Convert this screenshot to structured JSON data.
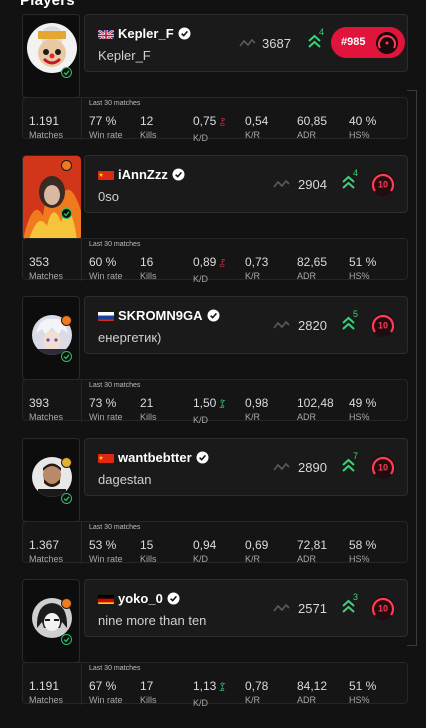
{
  "section": {
    "title": "Players"
  },
  "stat_labels": {
    "matches": "Matches",
    "winrate": "Win rate",
    "kills": "Kills",
    "kd": "K/D",
    "kr": "K/R",
    "adr": "ADR",
    "hs": "HS%",
    "last30": "Last 30 matches"
  },
  "players": [
    {
      "nick": "Kepler_F",
      "subtitle": "Kepler_F",
      "flag": "gb",
      "elo": "3687",
      "delta": "4",
      "rank": "#985",
      "level": "10",
      "matches": "1.191",
      "winrate": "77 %",
      "kills": "12",
      "kd": "0,75",
      "kd_trend": "down",
      "kr": "0,54",
      "adr": "60,85",
      "hs": "40 %",
      "avatar": "clown-avatar"
    },
    {
      "nick": "iAnnZzz",
      "subtitle": "0so",
      "flag": "cn",
      "elo": "2904",
      "delta": "4",
      "level": "10",
      "matches": "353",
      "winrate": "60 %",
      "kills": "16",
      "kd": "0,89",
      "kd_trend": "down",
      "kr": "0,73",
      "adr": "82,65",
      "hs": "51 %",
      "avatar": "fire-avatar"
    },
    {
      "nick": "SKROMN9GA",
      "subtitle": "енергетик)",
      "flag": "ru",
      "elo": "2820",
      "delta": "5",
      "level": "10",
      "matches": "393",
      "winrate": "73 %",
      "kills": "21",
      "kd": "1,50",
      "kd_trend": "up",
      "kr": "0,98",
      "adr": "102,48",
      "hs": "49 %",
      "avatar": "anime-avatar"
    },
    {
      "nick": "wantbebtter",
      "subtitle": "dagestan",
      "flag": "cn",
      "elo": "2890",
      "delta": "7",
      "level": "10",
      "matches": "1.367",
      "winrate": "53 %",
      "kills": "15",
      "kd": "0,94",
      "kd_trend": "none",
      "kr": "0,69",
      "adr": "72,81",
      "hs": "58 %",
      "avatar": "fighter-avatar"
    },
    {
      "nick": "yoko_0",
      "subtitle": "nine more than ten",
      "flag": "de",
      "elo": "2571",
      "delta": "3",
      "level": "10",
      "matches": "1.191",
      "winrate": "67 %",
      "kills": "17",
      "kd": "1,13",
      "kd_trend": "up",
      "kr": "0,78",
      "adr": "84,12",
      "hs": "51 %",
      "avatar": "mono-anime-avatar"
    }
  ],
  "colors": {
    "accent_red": "#e1153b",
    "up_green": "#3ed07a",
    "down_red": "#e0324d"
  }
}
